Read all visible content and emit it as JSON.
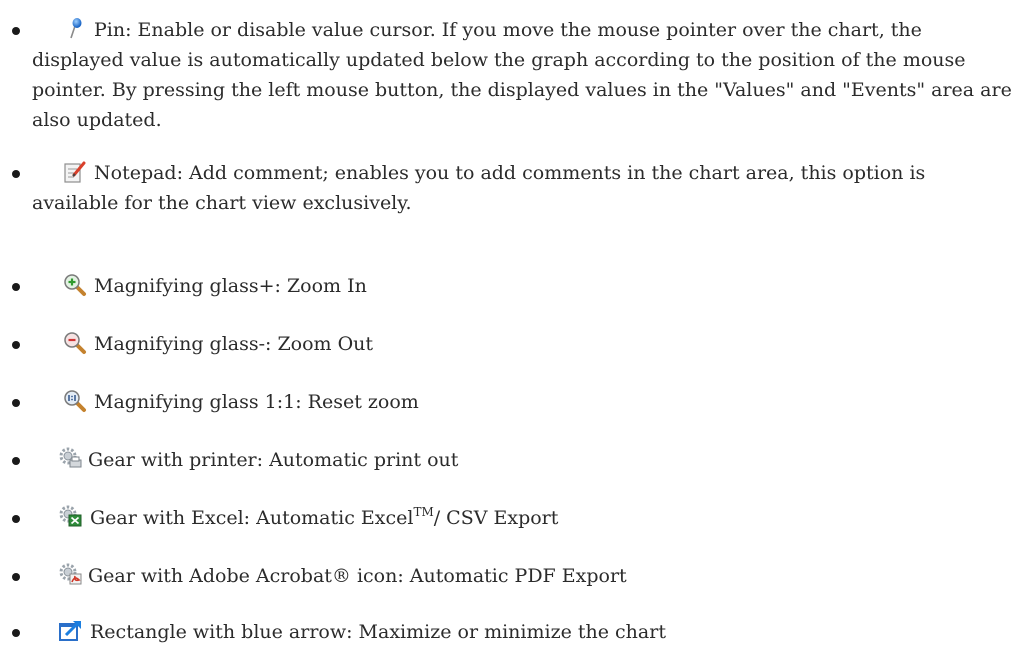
{
  "items": [
    {
      "icon": "pin-icon",
      "text": "Pin: Enable or disable value cursor. If you move the mouse pointer over the chart, the displayed value is automatically updated below the graph according to the position of the mouse pointer. By pressing the left mouse button, the displayed values in the \"Values\" and \"Events\" area are also updated."
    },
    {
      "icon": "notepad-icon",
      "text": "Notepad: Add comment; enables you to add comments in the chart area, this option is available for the chart view exclusively."
    },
    {
      "icon": "zoom-in-icon",
      "text": "Magnifying glass+: Zoom In"
    },
    {
      "icon": "zoom-out-icon",
      "text": "Magnifying glass-: Zoom Out"
    },
    {
      "icon": "zoom-reset-icon",
      "text": "Magnifying glass 1:1: Reset zoom"
    },
    {
      "icon": "gear-printer-icon",
      "text": "Gear with printer: Automatic print out"
    },
    {
      "icon": "gear-excel-icon",
      "text_before": "Gear with Excel: Automatic Excel",
      "superscript": "TM",
      "text_after": "/ CSV Export"
    },
    {
      "icon": "gear-pdf-icon",
      "text": "Gear with Adobe Acrobat® icon: Automatic PDF Export"
    },
    {
      "icon": "maximize-icon",
      "text": "Rectangle with blue arrow: Maximize or minimize the chart"
    }
  ]
}
